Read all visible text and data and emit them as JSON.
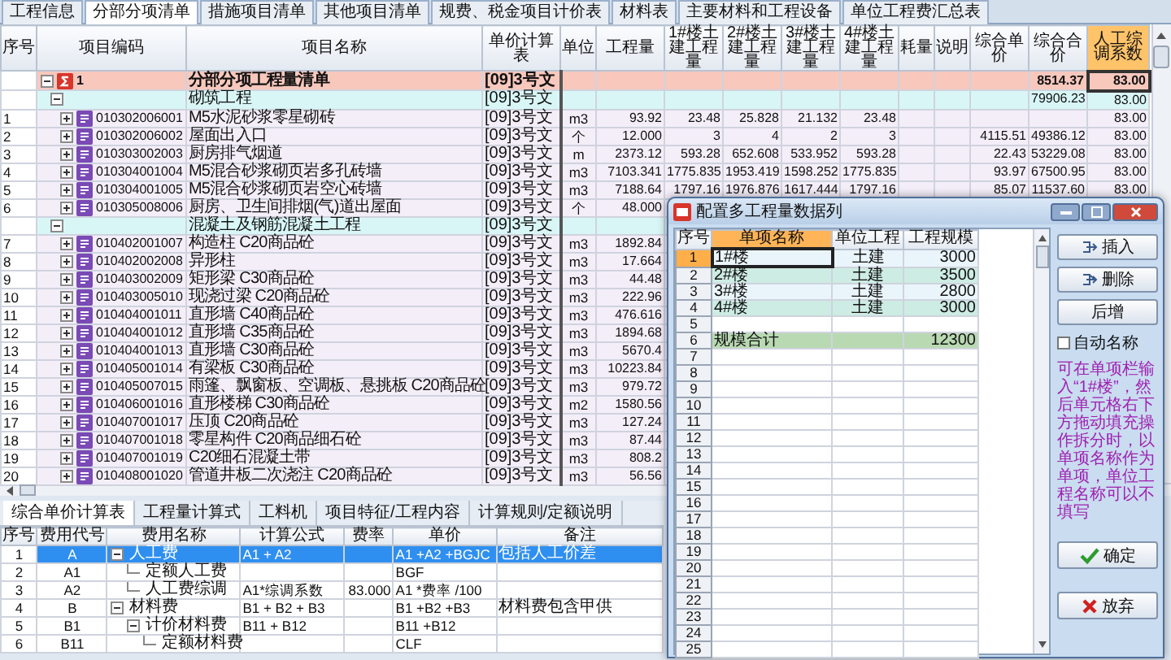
{
  "tabs": [
    {
      "label": "工程信息",
      "selected": false
    },
    {
      "label": "分部分项清单",
      "selected": true
    },
    {
      "label": "措施项目清单",
      "selected": false
    },
    {
      "label": "其他项目清单",
      "selected": false
    },
    {
      "label": "规费、税金项目计价表",
      "selected": false
    },
    {
      "label": "材料表",
      "selected": false
    },
    {
      "label": "主要材料和工程设备",
      "selected": false
    },
    {
      "label": "单位工程费汇总表",
      "selected": false
    }
  ],
  "main_table": {
    "columns": [
      "序号",
      "项目编码",
      "项目名称",
      "单价计算表",
      "单位",
      "工程量",
      "1#楼土建工程量",
      "2#楼土建工程量",
      "3#楼土建工程量",
      "4#楼土建工程量",
      "耗量",
      "说明",
      "综合单价",
      "综合合价",
      "人工综调系数"
    ],
    "rows": [
      {
        "kind": "group",
        "code": "1",
        "name": "分部分项工程量清单",
        "calc": "[09]3号文",
        "expanded": true,
        "total_price": "8514.37",
        "factor": "83.00",
        "children": [
          {
            "kind": "section",
            "name": "砌筑工程",
            "calc": "[09]3号文",
            "expanded": true,
            "total_price": "79906.23",
            "factor": "83.00",
            "children": [
              {
                "kind": "item",
                "no": "1",
                "code": "010302006001",
                "name": "M5水泥砂浆零星砌砖",
                "calc": "[09]3号文",
                "unit": "m3",
                "qty": "93.92",
                "builds": [
                  "23.48",
                  "25.828",
                  "21.132",
                  "23.48"
                ],
                "factor": "83.00",
                "expanded": false
              },
              {
                "kind": "item",
                "no": "2",
                "code": "010302006002",
                "name": "屋面出入口",
                "calc": "[09]3号文",
                "unit": "个",
                "qty": "12.000",
                "builds": [
                  "3",
                  "4",
                  "2",
                  "3"
                ],
                "unit_price": "4115.51",
                "total_price": "49386.12",
                "factor": "83.00",
                "expanded": false
              },
              {
                "kind": "item",
                "no": "3",
                "code": "010303002003",
                "name": "厨房排气烟道",
                "calc": "[09]3号文",
                "unit": "m",
                "qty": "2373.12",
                "builds": [
                  "593.28",
                  "652.608",
                  "533.952",
                  "593.28"
                ],
                "unit_price": "22.43",
                "total_price": "53229.08",
                "factor": "83.00",
                "expanded": false
              },
              {
                "kind": "item",
                "no": "4",
                "code": "010304001004",
                "name": "M5混合砂浆砌页岩多孔砖墙",
                "calc": "[09]3号文",
                "unit": "m3",
                "qty": "7103.341",
                "builds": [
                  "1775.835",
                  "1953.419",
                  "1598.252",
                  "1775.835"
                ],
                "unit_price": "93.97",
                "total_price": "67500.95",
                "factor": "83.00",
                "expanded": false
              },
              {
                "kind": "item",
                "no": "5",
                "code": "010304001005",
                "name": "M5混合砂浆砌页岩空心砖墙",
                "calc": "[09]3号文",
                "unit": "m3",
                "qty": "7188.64",
                "builds": [
                  "1797.16",
                  "1976.876",
                  "1617.444",
                  "1797.16"
                ],
                "unit_price": "85.07",
                "total_price": "11537.60",
                "factor": "83.00",
                "expanded": false
              },
              {
                "kind": "item",
                "no": "6",
                "code": "010305008006",
                "name": "厨房、卫生间排烟(气)道出屋面",
                "calc": "[09]3号文",
                "unit": "个",
                "qty": "48.000",
                "expanded": false
              }
            ]
          },
          {
            "kind": "section",
            "name": "混凝土及钢筋混凝土工程",
            "calc": "[09]3号文",
            "expanded": true,
            "children": [
              {
                "kind": "item",
                "no": "7",
                "code": "010402001007",
                "name": "构造柱 C20商品砼",
                "calc": "[09]3号文",
                "unit": "m3",
                "qty": "1892.84",
                "expanded": false
              },
              {
                "kind": "item",
                "no": "8",
                "code": "010402002008",
                "name": "异形柱",
                "calc": "[09]3号文",
                "unit": "m3",
                "qty": "17.664",
                "expanded": false
              },
              {
                "kind": "item",
                "no": "9",
                "code": "010403002009",
                "name": "矩形梁 C30商品砼",
                "calc": "[09]3号文",
                "unit": "m3",
                "qty": "44.48",
                "expanded": false
              },
              {
                "kind": "item",
                "no": "10",
                "code": "010403005010",
                "name": "现浇过梁 C20商品砼",
                "calc": "[09]3号文",
                "unit": "m3",
                "qty": "222.96",
                "expanded": false
              },
              {
                "kind": "item",
                "no": "11",
                "code": "010404001011",
                "name": "直形墙 C40商品砼",
                "calc": "[09]3号文",
                "unit": "m3",
                "qty": "476.616",
                "expanded": false
              },
              {
                "kind": "item",
                "no": "12",
                "code": "010404001012",
                "name": "直形墙 C35商品砼",
                "calc": "[09]3号文",
                "unit": "m3",
                "qty": "1894.68",
                "expanded": false
              },
              {
                "kind": "item",
                "no": "13",
                "code": "010404001013",
                "name": "直形墙 C30商品砼",
                "calc": "[09]3号文",
                "unit": "m3",
                "qty": "5670.4",
                "expanded": false
              },
              {
                "kind": "item",
                "no": "14",
                "code": "010405001014",
                "name": "有梁板 C30商品砼",
                "calc": "[09]3号文",
                "unit": "m3",
                "qty": "10223.84",
                "expanded": false
              },
              {
                "kind": "item",
                "no": "15",
                "code": "010405007015",
                "name": "雨篷、飘窗板、空调板、悬挑板 C20商品砼",
                "calc": "[09]3号文",
                "unit": "m3",
                "qty": "979.72",
                "expanded": false
              },
              {
                "kind": "item",
                "no": "16",
                "code": "010406001016",
                "name": "直形楼梯 C30商品砼",
                "calc": "[09]3号文",
                "unit": "m2",
                "qty": "1580.56",
                "expanded": false
              },
              {
                "kind": "item",
                "no": "17",
                "code": "010407001017",
                "name": "压顶 C20商品砼",
                "calc": "[09]3号文",
                "unit": "m3",
                "qty": "127.24",
                "expanded": false
              },
              {
                "kind": "item",
                "no": "18",
                "code": "010407001018",
                "name": "零星构件 C20商品细石砼",
                "calc": "[09]3号文",
                "unit": "m3",
                "qty": "87.44",
                "expanded": false
              },
              {
                "kind": "item",
                "no": "19",
                "code": "010407001019",
                "name": "C20细石混凝土带",
                "calc": "[09]3号文",
                "unit": "m3",
                "qty": "808.2",
                "expanded": false
              },
              {
                "kind": "item",
                "no": "20",
                "code": "010408001020",
                "name": "管道井板二次浇注 C20商品砼",
                "calc": "[09]3号文",
                "unit": "m3",
                "qty": "56.56",
                "expanded": false
              }
            ]
          }
        ]
      }
    ]
  },
  "bottom_tabs": [
    {
      "label": "综合单价计算表",
      "selected": true
    },
    {
      "label": "工程量计算式",
      "selected": false
    },
    {
      "label": "工料机",
      "selected": false
    },
    {
      "label": "项目特征/工程内容",
      "selected": false
    },
    {
      "label": "计算规则/定额说明",
      "selected": false
    }
  ],
  "cost_table": {
    "columns": [
      "序号",
      "费用代号",
      "费用名称",
      "计算公式",
      "费率",
      "单价",
      "备注"
    ],
    "rows": [
      {
        "no": "1",
        "code": "A",
        "name": "人工费",
        "formula": "A1 + A2",
        "price": "A1 +A2 +BGJC",
        "note": "包括人工价差",
        "selected": true,
        "expanded": true,
        "children": [
          {
            "no": "2",
            "code": "A1",
            "name": "定额人工费",
            "price": "BGF",
            "selected": false
          },
          {
            "no": "3",
            "code": "A2",
            "name": "人工费综调",
            "formula": "A1*综调系数",
            "rate": "83.000",
            "price": "A1 *费率 /100",
            "selected": false
          }
        ]
      },
      {
        "no": "4",
        "code": "B",
        "name": "材料费",
        "formula": "B1 + B2 + B3",
        "price": "B1 +B2 +B3",
        "note": "材料费包含甲供",
        "selected": false,
        "expanded": true,
        "children": [
          {
            "no": "5",
            "code": "B1",
            "name": "计价材料费",
            "formula": "B11 + B12",
            "price": "B11 +B12",
            "selected": false,
            "expanded": true,
            "children": [
              {
                "no": "6",
                "code": "B11",
                "name": "定额材料费",
                "price": "CLF",
                "selected": false
              }
            ]
          }
        ]
      }
    ]
  },
  "dialog": {
    "title": "配置多工程量数据列",
    "columns": [
      "序号",
      "单项名称",
      "单位工程",
      "工程规模"
    ],
    "rows": [
      {
        "no": "1",
        "kind": "item",
        "name": "1#楼",
        "unit": "土建",
        "scale": "3000",
        "selected": true
      },
      {
        "no": "2",
        "kind": "item",
        "name": "2#楼",
        "unit": "土建",
        "scale": "3500",
        "selected": false
      },
      {
        "no": "3",
        "kind": "item",
        "name": "3#楼",
        "unit": "土建",
        "scale": "2800",
        "selected": false
      },
      {
        "no": "4",
        "kind": "item",
        "name": "4#楼",
        "unit": "土建",
        "scale": "3000",
        "selected": false
      },
      {
        "no": "5",
        "kind": "blank",
        "selected": false
      },
      {
        "no": "6",
        "kind": "total",
        "name": "规模合计",
        "scale": "12300",
        "selected": false
      },
      {
        "no": "7",
        "kind": "blank",
        "selected": false
      },
      {
        "no": "8",
        "kind": "blank",
        "selected": false
      },
      {
        "no": "9",
        "kind": "blank",
        "selected": false
      },
      {
        "no": "10",
        "kind": "blank",
        "selected": false
      },
      {
        "no": "11",
        "kind": "blank",
        "selected": false
      },
      {
        "no": "12",
        "kind": "blank",
        "selected": false
      },
      {
        "no": "13",
        "kind": "blank",
        "selected": false
      },
      {
        "no": "14",
        "kind": "blank",
        "selected": false
      },
      {
        "no": "15",
        "kind": "blank",
        "selected": false
      },
      {
        "no": "16",
        "kind": "blank",
        "selected": false
      },
      {
        "no": "17",
        "kind": "blank",
        "selected": false
      },
      {
        "no": "18",
        "kind": "blank",
        "selected": false
      },
      {
        "no": "19",
        "kind": "blank",
        "selected": false
      },
      {
        "no": "20",
        "kind": "blank",
        "selected": false
      },
      {
        "no": "21",
        "kind": "blank",
        "selected": false
      },
      {
        "no": "22",
        "kind": "blank",
        "selected": false
      },
      {
        "no": "23",
        "kind": "blank",
        "selected": false
      },
      {
        "no": "24",
        "kind": "blank",
        "selected": false
      },
      {
        "no": "25",
        "kind": "blank",
        "selected": false
      }
    ],
    "buttons": [
      {
        "label": "插入",
        "kind": "insert"
      },
      {
        "label": "删除",
        "kind": "delete"
      },
      {
        "label": "后增",
        "kind": "plain"
      }
    ],
    "auto_name": {
      "label": "自动名称",
      "checked": false
    },
    "hint": "可在单项栏输入“1#楼”，然后单元格右下方拖动填充操作拆分时，以单项名称作为单项，单位工程名称可以不填写",
    "actions": [
      {
        "label": "确定",
        "kind": "ok"
      },
      {
        "label": "放弃",
        "kind": "cancel"
      }
    ]
  }
}
